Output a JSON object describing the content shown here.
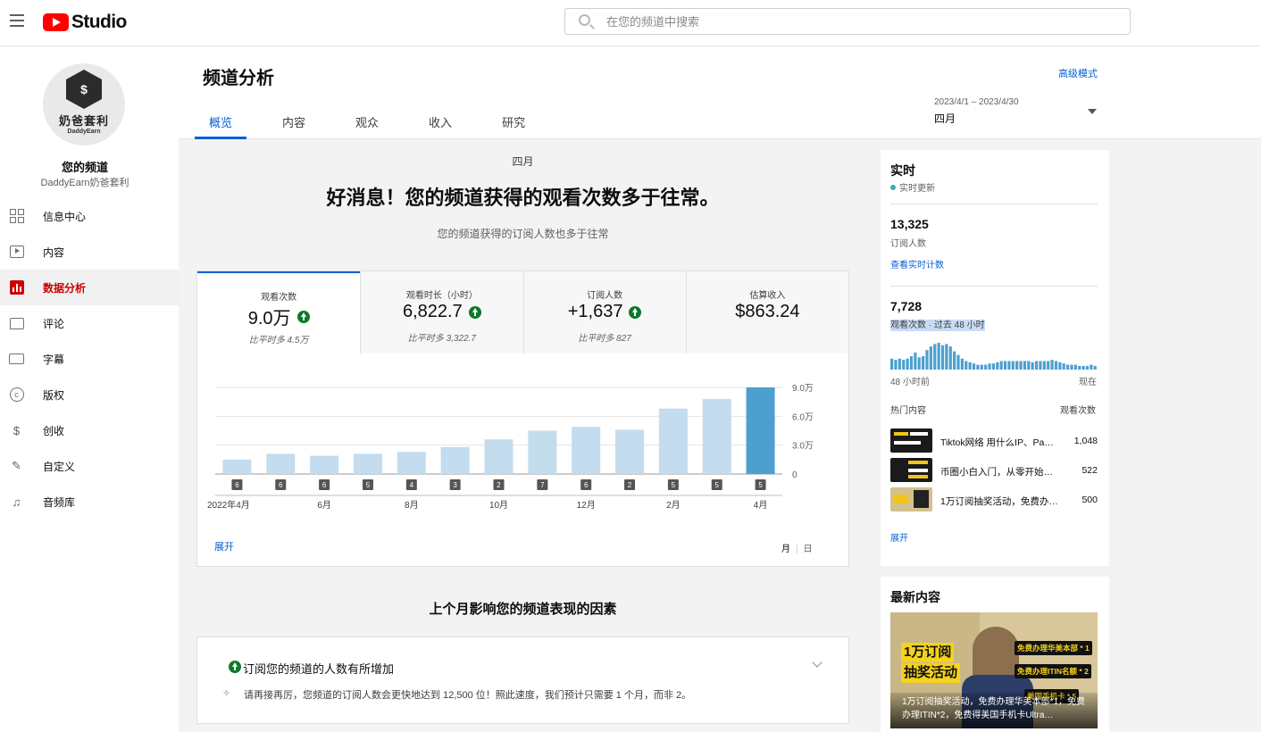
{
  "header": {
    "logo_text": "Studio",
    "search_placeholder": "在您的频道中搜索"
  },
  "sidebar": {
    "avatar_title": "奶爸套利",
    "avatar_sub": "DaddyEarn",
    "channel_label": "您的频道",
    "channel_name": "DaddyEarn奶爸套利",
    "items": [
      {
        "label": "信息中心",
        "icon": "dashboard-icon",
        "active": false
      },
      {
        "label": "内容",
        "icon": "content-icon",
        "active": false
      },
      {
        "label": "数据分析",
        "icon": "analytics-icon",
        "active": true
      },
      {
        "label": "评论",
        "icon": "comments-icon",
        "active": false
      },
      {
        "label": "字幕",
        "icon": "subtitles-icon",
        "active": false
      },
      {
        "label": "版权",
        "icon": "copyright-icon",
        "active": false
      },
      {
        "label": "创收",
        "icon": "monetization-icon",
        "active": false
      },
      {
        "label": "自定义",
        "icon": "customization-icon",
        "active": false
      },
      {
        "label": "音频库",
        "icon": "audio-library-icon",
        "active": false
      }
    ]
  },
  "page": {
    "title": "频道分析",
    "advanced_mode": "高级模式",
    "tabs": [
      "概览",
      "内容",
      "观众",
      "收入",
      "研究"
    ],
    "active_tab": 0,
    "date_range": "2023/4/1 – 2023/4/30",
    "date_label": "四月"
  },
  "overview": {
    "month": "四月",
    "headline": "好消息！您的频道获得的观看次数多于往常。",
    "subline": "您的频道获得的订阅人数也多于往常",
    "metrics": [
      {
        "label": "观看次数",
        "value": "9.0万",
        "up": true,
        "note": "比平时多 4.5万"
      },
      {
        "label": "观看时长（小时）",
        "value": "6,822.7",
        "up": true,
        "note": "比平时多 3,322.7"
      },
      {
        "label": "订阅人数",
        "value": "+1,637",
        "up": true,
        "note": "比平时多 827"
      },
      {
        "label": "估算收入",
        "value": "$863.24",
        "up": false,
        "note": ""
      }
    ],
    "expand": "展开",
    "toggle_month": "月",
    "toggle_day": "日"
  },
  "chart_data": {
    "type": "bar",
    "series_color": "#c3dcee",
    "highlight_color": "#4c9fcf",
    "months": [
      "2022-04",
      "2022-05",
      "2022-06",
      "2022-07",
      "2022-08",
      "2022-09",
      "2022-10",
      "2022-11",
      "2022-12",
      "2023-01",
      "2023-02",
      "2023-03",
      "2023-04"
    ],
    "values": [
      1.5,
      2.1,
      1.9,
      2.1,
      2.3,
      2.8,
      3.6,
      4.5,
      4.9,
      4.6,
      6.8,
      7.8,
      9.0
    ],
    "value_unit": "万",
    "badges": [
      6,
      6,
      6,
      5,
      4,
      3,
      2,
      7,
      6,
      2,
      5,
      5,
      5
    ],
    "x_labels": [
      "2022年4月",
      "",
      "6月",
      "",
      "8月",
      "",
      "10月",
      "",
      "12月",
      "",
      "2月",
      "",
      "4月"
    ],
    "y_ticks": [
      "0",
      "3.0万",
      "6.0万",
      "9.0万"
    ],
    "y_tick_values": [
      0,
      3,
      6,
      9
    ],
    "ylim": [
      0,
      9
    ],
    "grid": true
  },
  "factors": {
    "title": "上个月影响您的频道表现的因素",
    "heading": "订阅您的频道的人数有所增加",
    "text": "请再接再厉，您频道的订阅人数会更快地达到 12,500 位！照此速度，我们预计只需要 1 个月，而非 2。"
  },
  "realtime": {
    "title": "实时",
    "live": "实时更新",
    "subs_value": "13,325",
    "subs_label": "订阅人数",
    "live_count_link": "查看实时计数",
    "views_value": "7,728",
    "views_label": "观看次数 · 过去 48 小时",
    "hourly_views": [
      9,
      8,
      9,
      8,
      9,
      11,
      14,
      10,
      11,
      16,
      19,
      21,
      22,
      20,
      21,
      19,
      15,
      12,
      9,
      7,
      6,
      5,
      4,
      4,
      4,
      5,
      5,
      6,
      7,
      7,
      7,
      7,
      7,
      7,
      7,
      7,
      6,
      7,
      7,
      7,
      7,
      8,
      7,
      6,
      5,
      4,
      4,
      4,
      3,
      3,
      3,
      4,
      3
    ],
    "axis_left": "48 小时前",
    "axis_right": "现在",
    "top_header": "热门内容",
    "views_header": "观看次数",
    "top_content": [
      {
        "title": "Tiktok网络 用什么IP、Pa…",
        "views": "1,048"
      },
      {
        "title": "币圈小白入门，从零开始第…",
        "views": "522"
      },
      {
        "title": "1万订阅抽奖活动，免费办…",
        "views": "500"
      }
    ],
    "expand": "展开"
  },
  "latest": {
    "title": "最新内容",
    "thumb_big_1": "1万订阅",
    "thumb_big_2": "抽奖活动",
    "thumb_tags": [
      "免费办理华美本部 * 1",
      "免费办理ITIN名额 * 2",
      "美国手机卡 * 5"
    ],
    "caption": "1万订阅抽奖活动，免费办理华美本部*1，免费办理ITIN*2，免费得美国手机卡Ultra…"
  }
}
